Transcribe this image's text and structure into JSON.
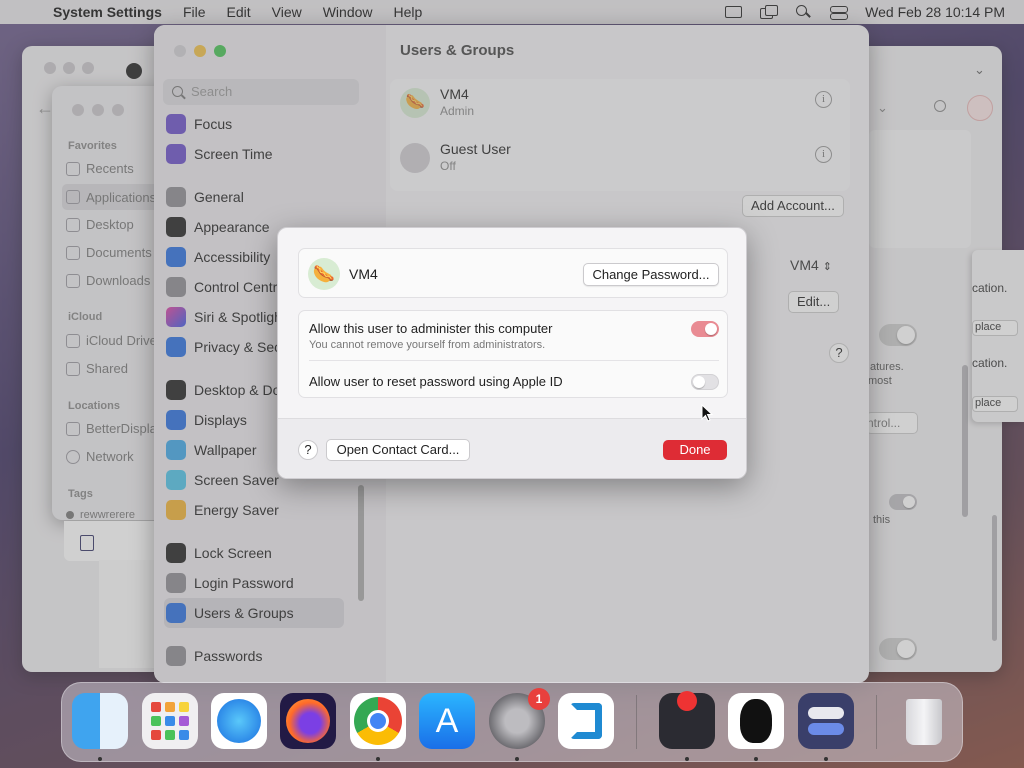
{
  "menubar": {
    "app_name": "System Settings",
    "menus": [
      "File",
      "Edit",
      "View",
      "Window",
      "Help"
    ],
    "clock": "Wed Feb 28  10:14 PM"
  },
  "finder": {
    "favorites_header": "Favorites",
    "favorites": [
      "Recents",
      "Applications",
      "Desktop",
      "Documents",
      "Downloads"
    ],
    "icloud_header": "iCloud",
    "icloud": [
      "iCloud Drive",
      "Shared"
    ],
    "locations_header": "Locations",
    "locations": [
      "BetterDisplay",
      "Network"
    ],
    "tags_header": "Tags",
    "tags": [
      "rewwrerere"
    ]
  },
  "browser": {
    "right_card_texts": [
      "cation.",
      "cation."
    ],
    "right_card_buttons": [
      "place",
      "place"
    ],
    "side_fragments": [
      "atures.",
      "most",
      "ntrol...",
      "this"
    ]
  },
  "settings": {
    "title": "Users & Groups",
    "search_placeholder": "Search",
    "sidebar": [
      "Focus",
      "Screen Time",
      "General",
      "Appearance",
      "Accessibility",
      "Control Centre",
      "Siri & Spotlight",
      "Privacy & Security",
      "Desktop & Dock",
      "Displays",
      "Wallpaper",
      "Screen Saver",
      "Energy Saver",
      "Lock Screen",
      "Login Password",
      "Users & Groups",
      "Passwords"
    ],
    "users": [
      {
        "name": "VM4",
        "role": "Admin"
      },
      {
        "name": "Guest User",
        "role": "Off"
      }
    ],
    "add_account": "Add Account...",
    "auto_login_value": "VM4",
    "edit": "Edit..."
  },
  "sheet": {
    "user_name": "VM4",
    "change_password": "Change Password...",
    "option1_label": "Allow this user to administer this computer",
    "option1_sub": "You cannot remove yourself from administrators.",
    "option1_on": true,
    "option2_label": "Allow user to reset password using Apple ID",
    "option2_on": false,
    "help": "?",
    "open_contact": "Open Contact Card...",
    "done": "Done"
  },
  "dock": {
    "apps": [
      "Finder",
      "Launchpad",
      "Safari",
      "Firefox",
      "Chrome",
      "App Store",
      "System Settings",
      "Visual Studio Code",
      "Joystick",
      "Tux",
      "Toggles",
      "Trash"
    ],
    "settings_badge": "1"
  },
  "colors": {
    "accent_red": "#de2c35",
    "toggle_on": "#e98b93"
  }
}
